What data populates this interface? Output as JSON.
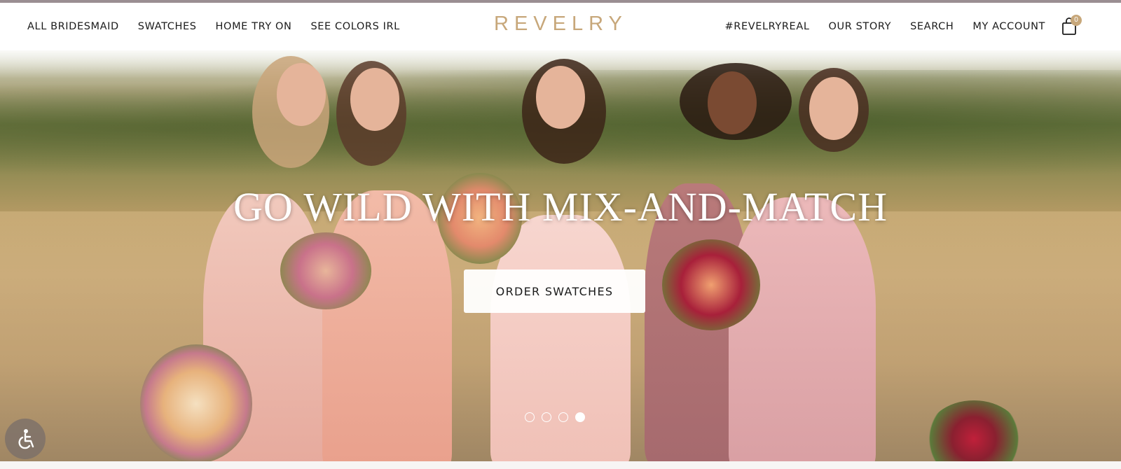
{
  "brand": {
    "logo": "REVELRY"
  },
  "nav": {
    "left": [
      "ALL BRIDESMAID",
      "SWATCHES",
      "HOME TRY ON",
      "SEE COLORS IRL"
    ],
    "right": [
      "#REVELRYREAL",
      "OUR STORY",
      "SEARCH",
      "MY ACCOUNT"
    ]
  },
  "cart": {
    "icon": "shopping-bag-icon",
    "count": "0"
  },
  "hero": {
    "title": "GO WILD WITH MIX-AND-MATCH",
    "cta": "ORDER SWATCHES",
    "carousel": {
      "slides": 4,
      "active": 4
    }
  },
  "accessibility": {
    "icon": "accessibility-icon"
  },
  "colors": {
    "logo": "#c7a77a",
    "nav_text": "#1b1b1b",
    "hero_text": "#ffffff"
  }
}
